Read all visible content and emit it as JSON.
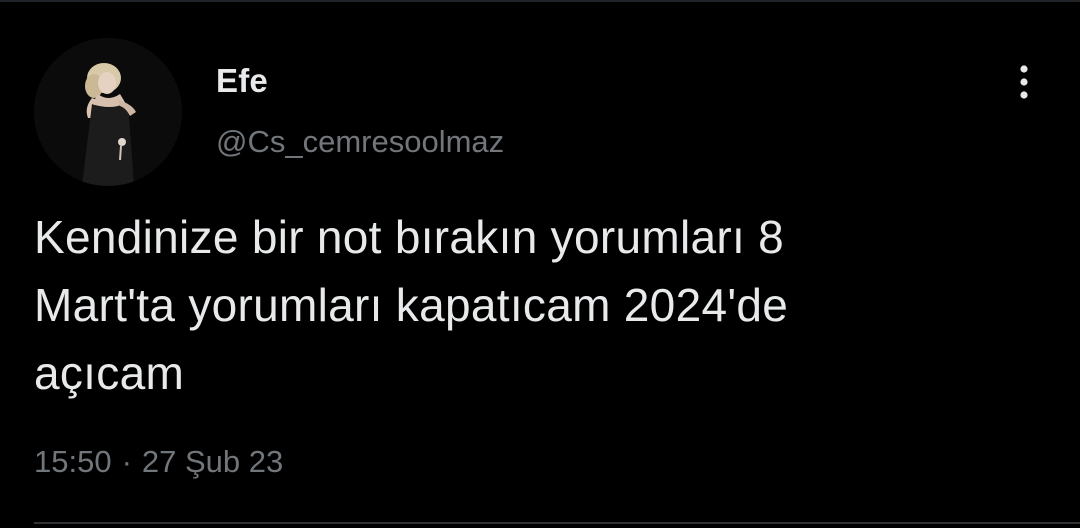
{
  "tweet": {
    "author": {
      "display_name": "Efe",
      "handle": "@Cs_cemresoolmaz",
      "avatar": "profile-photo"
    },
    "text": "Kendinize bir not bırakın yorumları 8\nMart'ta yorumları kapatıcam 2024'de\naçıcam",
    "time": "15:50",
    "separator": "·",
    "date": "27 Şub 23",
    "more_icon": "vertical-ellipsis-icon"
  },
  "colors": {
    "background": "#000000",
    "primary_text": "#e7e9ea",
    "secondary_text": "#71767b",
    "divider": "#2f3336"
  }
}
